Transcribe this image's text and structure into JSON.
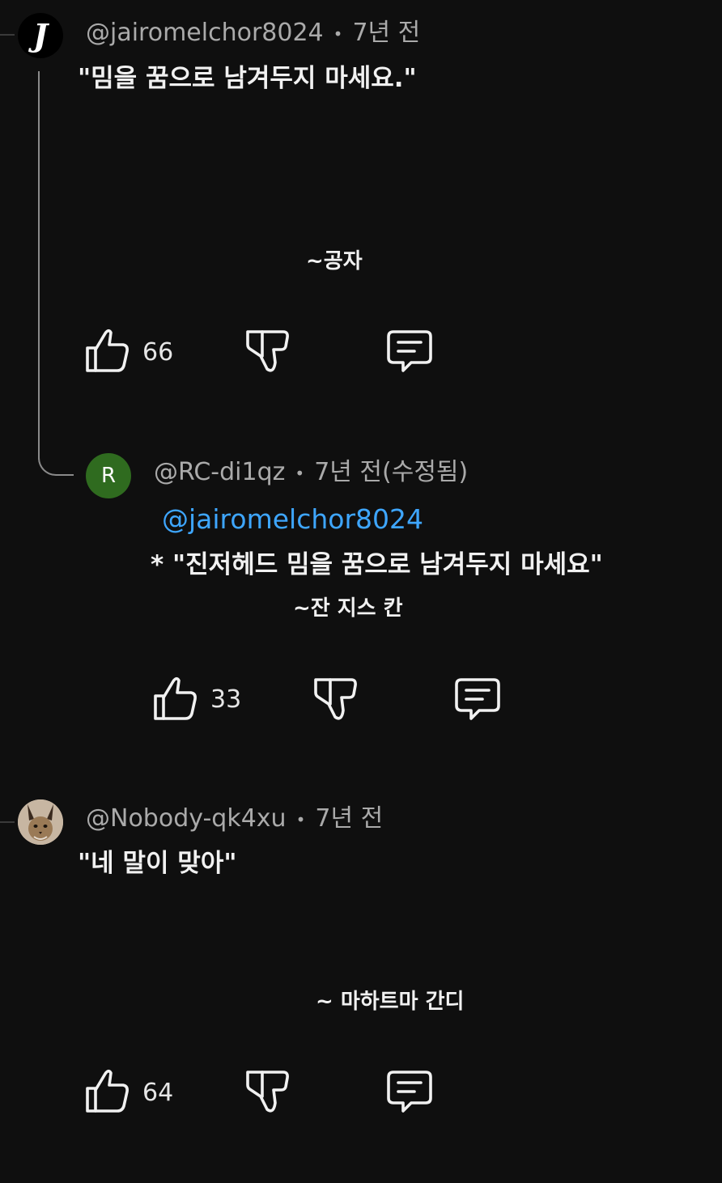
{
  "comments": [
    {
      "author": "@jairomelchor8024",
      "time": "7년 전",
      "avatar_letter": "J",
      "line1": "\"밈을 꿈으로 남겨두지 마세요.\"",
      "line2": "~공자",
      "likes": "66"
    },
    {
      "author": "@RC-di1qz",
      "time": "7년 전(수정됨)",
      "avatar_letter": "R",
      "mention": "@jairomelchor8024",
      "line1": "* \"진저헤드 밈을 꿈으로 남겨두지 마세요\"",
      "line2": "~잔 지스 칸",
      "likes": "33"
    },
    {
      "author": "@Nobody-qk4xu",
      "time": "7년 전",
      "avatar_desc": "caracal-cat-avatar",
      "line1": "\"네 말이 맞아\"",
      "line2": "~ 마하트마 간디",
      "likes": "64"
    }
  ],
  "separator": "•",
  "colors": {
    "background": "#0f0f0f",
    "text": "#f1f1f1",
    "meta": "#aaaaaa",
    "link": "#3ea6ff",
    "avatar_r": "#2f6b1f"
  },
  "icons": {
    "like": "thumbs-up-icon",
    "dislike": "thumbs-down-icon",
    "reply": "comment-reply-icon"
  }
}
